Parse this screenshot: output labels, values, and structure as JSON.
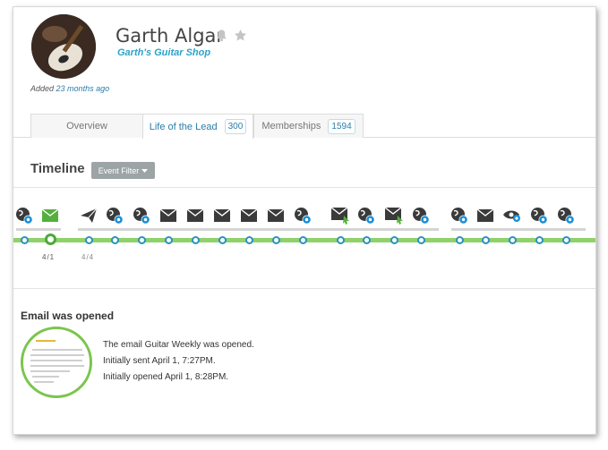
{
  "contact": {
    "name": "Garth Algar",
    "company": "Garth's Guitar Shop",
    "added_prefix": "Added",
    "added_ago": "23 months ago"
  },
  "tabs": [
    {
      "label": "Overview",
      "count": ""
    },
    {
      "label": "Life of the Lead",
      "count": "300"
    },
    {
      "label": "Memberships",
      "count": "1594"
    }
  ],
  "active_tab": "Life of the Lead",
  "timeline": {
    "title": "Timeline",
    "filter_label": "Event Filter",
    "events": [
      "chrome",
      "email",
      "send",
      "chrome",
      "chrome",
      "email",
      "email",
      "email",
      "email",
      "email",
      "chrome",
      "email-click",
      "chrome",
      "email-click",
      "chrome",
      "chrome",
      "email",
      "view",
      "chrome",
      "chrome"
    ],
    "dates": [
      "4/1",
      "4/4"
    ]
  },
  "detail": {
    "title": "Email was opened",
    "line1": "The email Guitar Weekly was opened.",
    "line2": "Initially sent April 1, 7:27PM.",
    "line3": "Initially opened April 1, 8:28PM."
  },
  "colors": {
    "accent_blue": "#2a92c0",
    "company_blue": "#2ba3c7",
    "track_green": "#8fd16a",
    "selected_green": "#4da93a"
  }
}
